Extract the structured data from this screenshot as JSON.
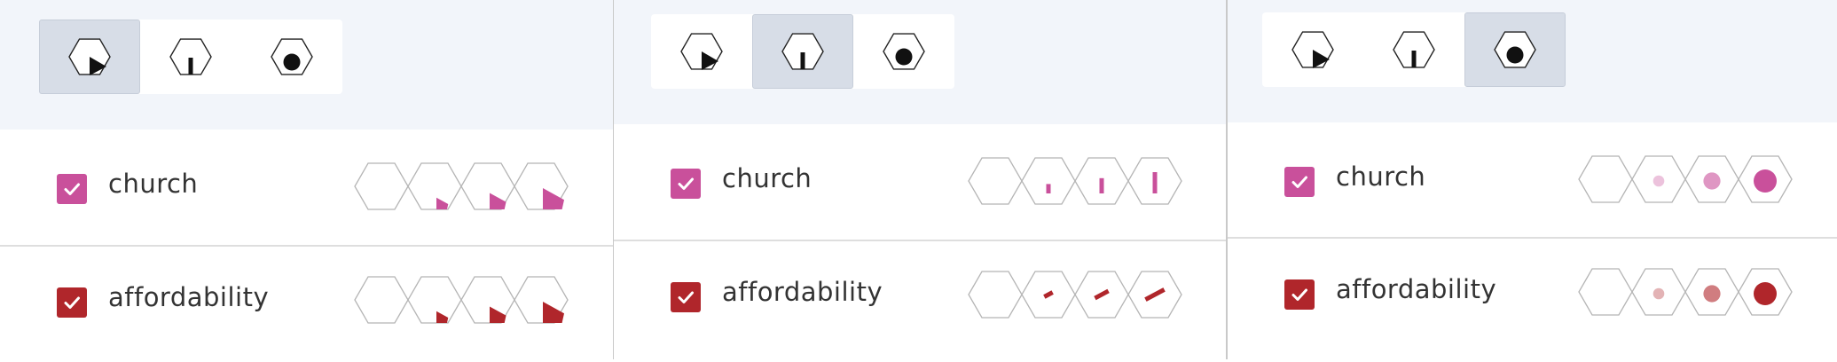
{
  "panels": [
    {
      "mode_buttons": [
        {
          "icon": "hex-wedge-icon",
          "active": true
        },
        {
          "icon": "hex-bar-icon",
          "active": false
        },
        {
          "icon": "hex-dot-icon",
          "active": false
        }
      ],
      "glyph_style": "wedge",
      "rows": [
        {
          "label": "church",
          "checked": true,
          "color": "#c9509b"
        },
        {
          "label": "affordability",
          "checked": true,
          "color": "#b0262b"
        }
      ]
    },
    {
      "mode_buttons": [
        {
          "icon": "hex-wedge-icon",
          "active": false
        },
        {
          "icon": "hex-bar-icon",
          "active": true
        },
        {
          "icon": "hex-dot-icon",
          "active": false
        }
      ],
      "glyph_style": "bar",
      "rows": [
        {
          "label": "church",
          "checked": true,
          "color": "#c9509b"
        },
        {
          "label": "affordability",
          "checked": true,
          "color": "#b0262b"
        }
      ]
    },
    {
      "mode_buttons": [
        {
          "icon": "hex-wedge-icon",
          "active": false
        },
        {
          "icon": "hex-bar-icon",
          "active": false
        },
        {
          "icon": "hex-dot-icon",
          "active": true
        }
      ],
      "glyph_style": "dot",
      "rows": [
        {
          "label": "church",
          "checked": true,
          "color": "#c9509b"
        },
        {
          "label": "affordability",
          "checked": true,
          "color": "#b0262b"
        }
      ]
    }
  ],
  "legend_levels": [
    0,
    0.33,
    0.66,
    1
  ]
}
